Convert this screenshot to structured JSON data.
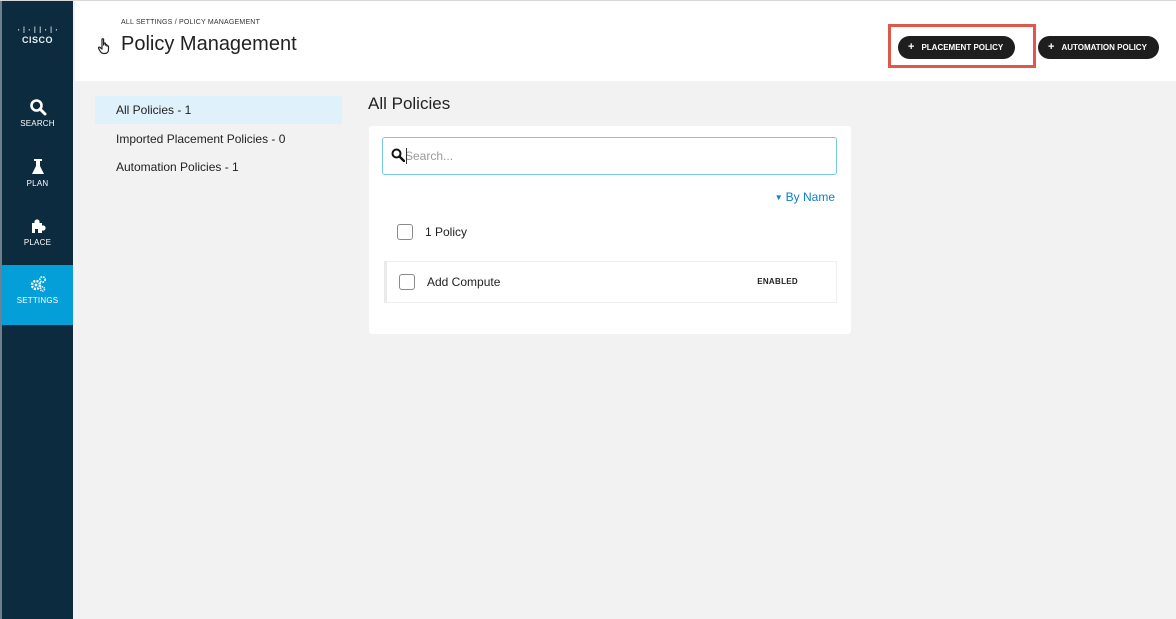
{
  "logo": {
    "bars": "·ǀ·ǀǀ·ǀ·",
    "text": "CISCO"
  },
  "nav": {
    "items": [
      {
        "label": "SEARCH",
        "icon": "search-icon"
      },
      {
        "label": "PLAN",
        "icon": "flask-icon"
      },
      {
        "label": "PLACE",
        "icon": "puzzle-icon"
      },
      {
        "label": "SETTINGS",
        "icon": "gears-icon",
        "active": true
      }
    ]
  },
  "header": {
    "breadcrumb": "ALL SETTINGS / POLICY MANAGEMENT",
    "title": "Policy Management",
    "title_icon": "hand-pointer-icon",
    "buttons": {
      "placement_policy": "PLACEMENT POLICY",
      "automation_policy": "AUTOMATION POLICY",
      "plus": "+"
    }
  },
  "subnav": {
    "items": [
      {
        "label": "All Policies - 1",
        "active": true
      },
      {
        "label": "Imported Placement Policies - 0"
      },
      {
        "label": "Automation Policies - 1"
      }
    ]
  },
  "main": {
    "heading": "All Policies",
    "search": {
      "placeholder": "Search...",
      "value": ""
    },
    "sort_label": "By Name",
    "count_label": "1 Policy",
    "policies": [
      {
        "name": "Add Compute",
        "status": "ENABLED"
      }
    ]
  },
  "colors": {
    "nav_bg": "#0d2b3e",
    "nav_active": "#049fd9",
    "button_bg": "#1e1e1e",
    "highlight": "#e0574b",
    "link": "#0a7fc7",
    "subnav_active": "#dff1fa"
  }
}
